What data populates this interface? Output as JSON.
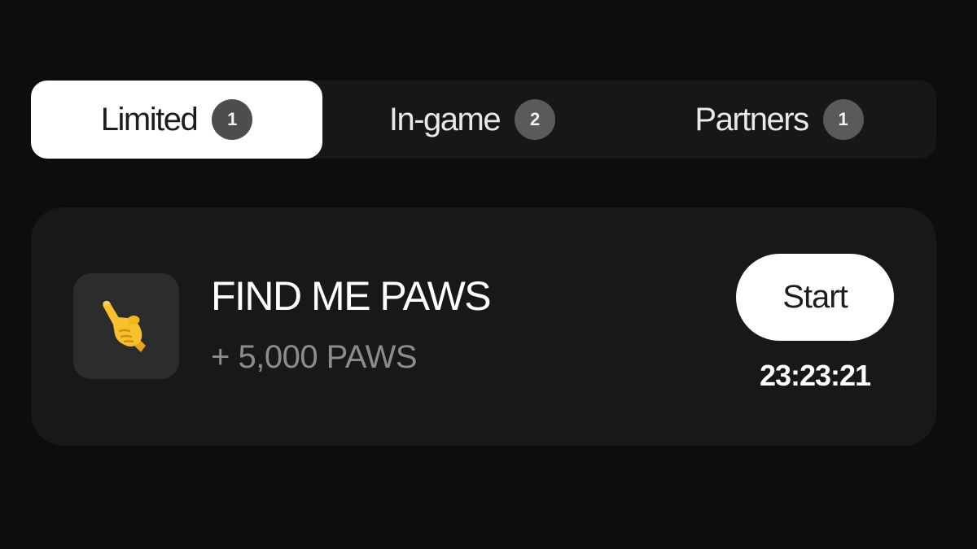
{
  "tabs": [
    {
      "label": "Limited",
      "count": "1",
      "active": true
    },
    {
      "label": "In-game",
      "count": "2",
      "active": false
    },
    {
      "label": "Partners",
      "count": "1",
      "active": false
    }
  ],
  "task": {
    "icon": "pointing-hand-icon",
    "title": "FIND ME PAWS",
    "reward": "+ 5,000 PAWS",
    "button_label": "Start",
    "timer": "23:23:21"
  },
  "colors": {
    "background": "#0d0d0d",
    "card": "#181818",
    "active_tab": "#ffffff",
    "badge": "#5a5a5a",
    "muted_text": "#8c8c8c"
  }
}
